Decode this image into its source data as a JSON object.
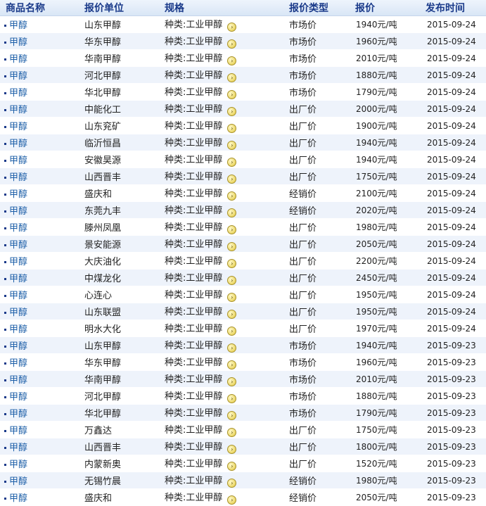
{
  "headers": {
    "name": "商品名称",
    "unit": "报价单位",
    "spec": "规格",
    "type": "报价类型",
    "price": "报价",
    "date": "发布时间"
  },
  "icons": {
    "detail_arrow": "arrow-right-circle-icon"
  },
  "rows": [
    {
      "name": "甲醇",
      "unit": "山东甲醇",
      "spec": "种类:工业甲醇",
      "type": "市场价",
      "price": "1940元/吨",
      "date": "2015-09-24"
    },
    {
      "name": "甲醇",
      "unit": "华东甲醇",
      "spec": "种类:工业甲醇",
      "type": "市场价",
      "price": "1960元/吨",
      "date": "2015-09-24"
    },
    {
      "name": "甲醇",
      "unit": "华南甲醇",
      "spec": "种类:工业甲醇",
      "type": "市场价",
      "price": "2010元/吨",
      "date": "2015-09-24"
    },
    {
      "name": "甲醇",
      "unit": "河北甲醇",
      "spec": "种类:工业甲醇",
      "type": "市场价",
      "price": "1880元/吨",
      "date": "2015-09-24"
    },
    {
      "name": "甲醇",
      "unit": "华北甲醇",
      "spec": "种类:工业甲醇",
      "type": "市场价",
      "price": "1790元/吨",
      "date": "2015-09-24"
    },
    {
      "name": "甲醇",
      "unit": "中能化工",
      "spec": "种类:工业甲醇",
      "type": "出厂价",
      "price": "2000元/吨",
      "date": "2015-09-24"
    },
    {
      "name": "甲醇",
      "unit": "山东兖矿",
      "spec": "种类:工业甲醇",
      "type": "出厂价",
      "price": "1900元/吨",
      "date": "2015-09-24"
    },
    {
      "name": "甲醇",
      "unit": "临沂恒昌",
      "spec": "种类:工业甲醇",
      "type": "出厂价",
      "price": "1940元/吨",
      "date": "2015-09-24"
    },
    {
      "name": "甲醇",
      "unit": "安徽昊源",
      "spec": "种类:工业甲醇",
      "type": "出厂价",
      "price": "1940元/吨",
      "date": "2015-09-24"
    },
    {
      "name": "甲醇",
      "unit": "山西晋丰",
      "spec": "种类:工业甲醇",
      "type": "出厂价",
      "price": "1750元/吨",
      "date": "2015-09-24"
    },
    {
      "name": "甲醇",
      "unit": "盛庆和",
      "spec": "种类:工业甲醇",
      "type": "经销价",
      "price": "2100元/吨",
      "date": "2015-09-24"
    },
    {
      "name": "甲醇",
      "unit": "东莞九丰",
      "spec": "种类:工业甲醇",
      "type": "经销价",
      "price": "2020元/吨",
      "date": "2015-09-24"
    },
    {
      "name": "甲醇",
      "unit": "滕州凤凰",
      "spec": "种类:工业甲醇",
      "type": "出厂价",
      "price": "1980元/吨",
      "date": "2015-09-24"
    },
    {
      "name": "甲醇",
      "unit": "景安能源",
      "spec": "种类:工业甲醇",
      "type": "出厂价",
      "price": "2050元/吨",
      "date": "2015-09-24"
    },
    {
      "name": "甲醇",
      "unit": "大庆油化",
      "spec": "种类:工业甲醇",
      "type": "出厂价",
      "price": "2200元/吨",
      "date": "2015-09-24"
    },
    {
      "name": "甲醇",
      "unit": "中煤龙化",
      "spec": "种类:工业甲醇",
      "type": "出厂价",
      "price": "2450元/吨",
      "date": "2015-09-24"
    },
    {
      "name": "甲醇",
      "unit": "心连心",
      "spec": "种类:工业甲醇",
      "type": "出厂价",
      "price": "1950元/吨",
      "date": "2015-09-24"
    },
    {
      "name": "甲醇",
      "unit": "山东联盟",
      "spec": "种类:工业甲醇",
      "type": "出厂价",
      "price": "1950元/吨",
      "date": "2015-09-24"
    },
    {
      "name": "甲醇",
      "unit": "明水大化",
      "spec": "种类:工业甲醇",
      "type": "出厂价",
      "price": "1970元/吨",
      "date": "2015-09-24"
    },
    {
      "name": "甲醇",
      "unit": "山东甲醇",
      "spec": "种类:工业甲醇",
      "type": "市场价",
      "price": "1940元/吨",
      "date": "2015-09-23"
    },
    {
      "name": "甲醇",
      "unit": "华东甲醇",
      "spec": "种类:工业甲醇",
      "type": "市场价",
      "price": "1960元/吨",
      "date": "2015-09-23"
    },
    {
      "name": "甲醇",
      "unit": "华南甲醇",
      "spec": "种类:工业甲醇",
      "type": "市场价",
      "price": "2010元/吨",
      "date": "2015-09-23"
    },
    {
      "name": "甲醇",
      "unit": "河北甲醇",
      "spec": "种类:工业甲醇",
      "type": "市场价",
      "price": "1880元/吨",
      "date": "2015-09-23"
    },
    {
      "name": "甲醇",
      "unit": "华北甲醇",
      "spec": "种类:工业甲醇",
      "type": "市场价",
      "price": "1790元/吨",
      "date": "2015-09-23"
    },
    {
      "name": "甲醇",
      "unit": "万鑫达",
      "spec": "种类:工业甲醇",
      "type": "出厂价",
      "price": "1750元/吨",
      "date": "2015-09-23"
    },
    {
      "name": "甲醇",
      "unit": "山西晋丰",
      "spec": "种类:工业甲醇",
      "type": "出厂价",
      "price": "1800元/吨",
      "date": "2015-09-23"
    },
    {
      "name": "甲醇",
      "unit": "内蒙新奥",
      "spec": "种类:工业甲醇",
      "type": "出厂价",
      "price": "1520元/吨",
      "date": "2015-09-23"
    },
    {
      "name": "甲醇",
      "unit": "无锡竹晨",
      "spec": "种类:工业甲醇",
      "type": "经销价",
      "price": "1980元/吨",
      "date": "2015-09-23"
    },
    {
      "name": "甲醇",
      "unit": "盛庆和",
      "spec": "种类:工业甲醇",
      "type": "经销价",
      "price": "2050元/吨",
      "date": "2015-09-23"
    }
  ]
}
